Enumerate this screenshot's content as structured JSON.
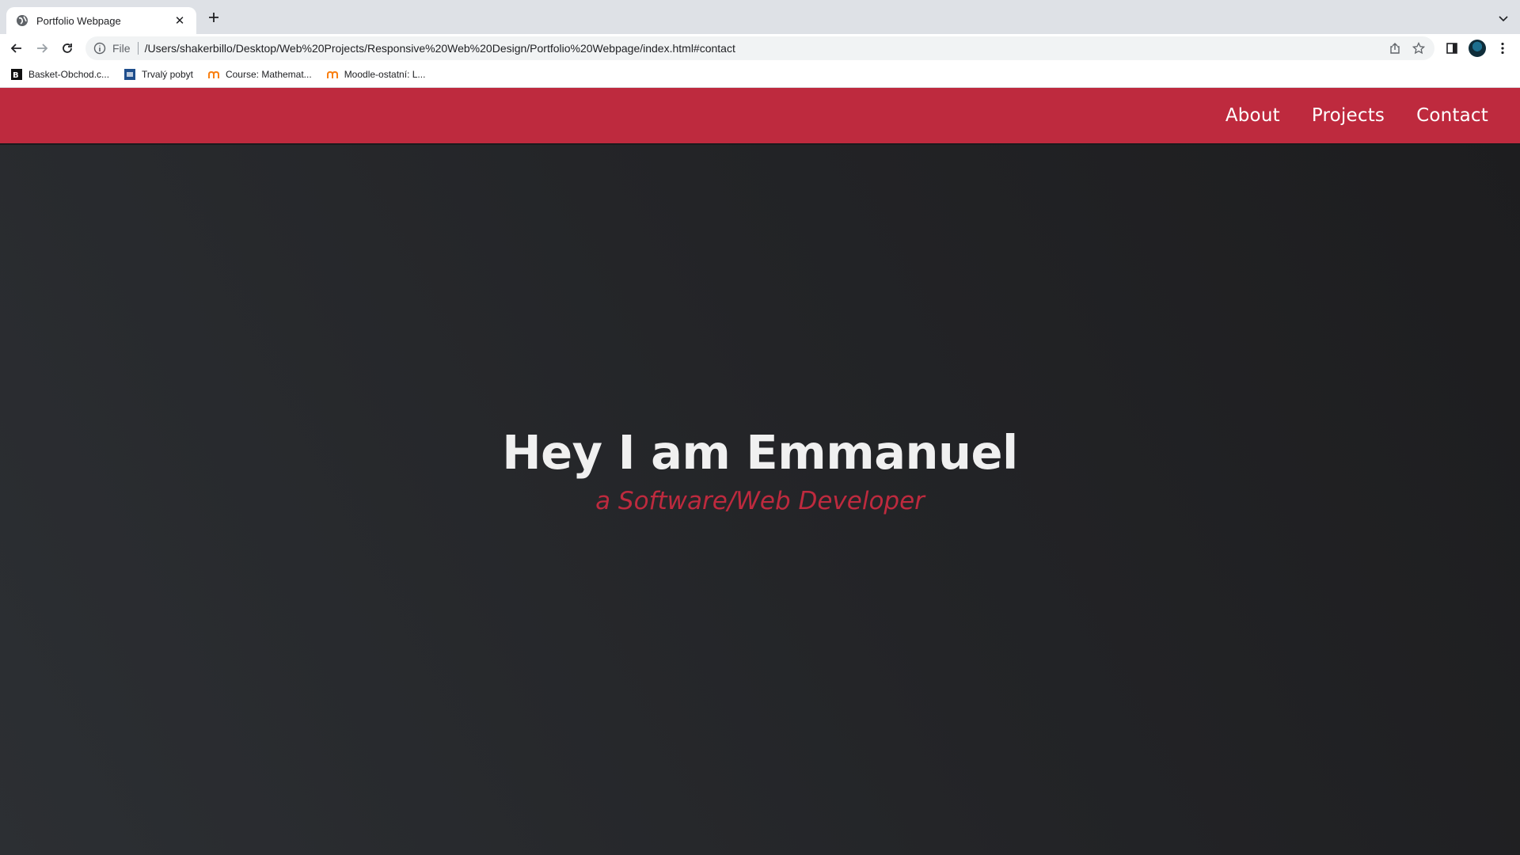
{
  "browser": {
    "tab_title": "Portfolio Webpage",
    "scheme_label": "File",
    "url": "/Users/shakerbillo/Desktop/Web%20Projects/Responsive%20Web%20Design/Portfolio%20Webpage/index.html#contact",
    "bookmarks": [
      {
        "label": "Basket-Obchod.c...",
        "icon": "basket-icon"
      },
      {
        "label": "Trvalý pobyt",
        "icon": "mvcr-icon"
      },
      {
        "label": "Course: Mathemat...",
        "icon": "moodle-icon"
      },
      {
        "label": "Moodle-ostatní: L...",
        "icon": "moodle-icon"
      }
    ]
  },
  "site": {
    "nav": [
      "About",
      "Projects",
      "Contact"
    ],
    "colors": {
      "accent": "#be2a3e",
      "background": "#232427"
    }
  },
  "hero": {
    "title": "Hey I am Emmanuel",
    "subtitle": "a Software/Web Developer"
  }
}
